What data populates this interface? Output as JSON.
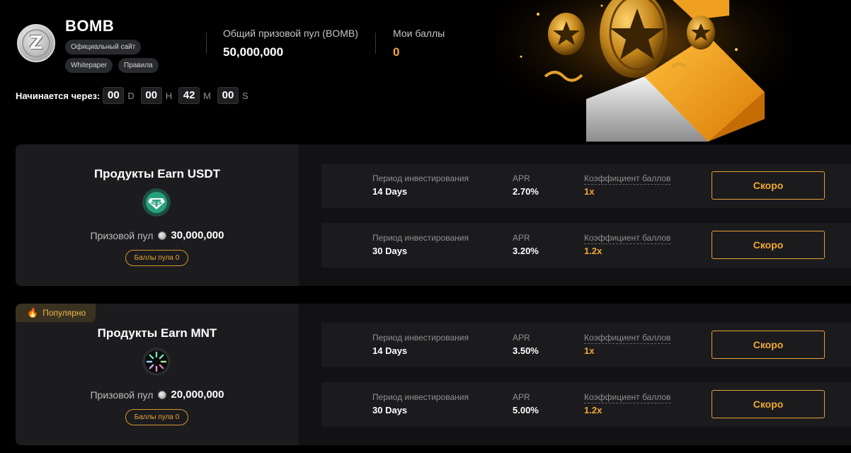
{
  "header": {
    "token_name": "BOMB",
    "token_logo_letter": "Z",
    "links": [
      "Официальный сайт",
      "Whitepaper",
      "Правила"
    ],
    "total_pool_label": "Общий призовой пул (BOMB)",
    "total_pool_value": "50,000,000",
    "my_points_label": "Мои баллы",
    "my_points_value": "0",
    "countdown": {
      "label": "Начинается через:",
      "days": "00",
      "days_unit": "D",
      "hours": "00",
      "hours_unit": "H",
      "minutes": "42",
      "minutes_unit": "M",
      "seconds": "00",
      "seconds_unit": "S"
    }
  },
  "products": [
    {
      "title": "Продукты Earn USDT",
      "icon": "tether-icon",
      "pool_label": "Призовой пул",
      "pool_value": "30,000,000",
      "points_button": "Баллы пула 0",
      "rows": [
        {
          "period_label": "Период инвестирования",
          "period": "14 Days",
          "apr_label": "APR",
          "apr": "2.70%",
          "coef_label": "Коэффициент баллов",
          "coef": "1x",
          "button": "Скоро"
        },
        {
          "period_label": "Период инвестирования",
          "period": "30 Days",
          "apr_label": "APR",
          "apr": "3.20%",
          "coef_label": "Коэффициент баллов",
          "coef": "1.2x",
          "button": "Скоро"
        }
      ]
    },
    {
      "badge": "Популярно",
      "title": "Продукты Earn MNT",
      "icon": "mantle-icon",
      "pool_label": "Призовой пул",
      "pool_value": "20,000,000",
      "points_button": "Баллы пула 0",
      "rows": [
        {
          "period_label": "Период инвестирования",
          "period": "14 Days",
          "apr_label": "APR",
          "apr": "3.50%",
          "coef_label": "Коэффициент баллов",
          "coef": "1x",
          "button": "Скоро"
        },
        {
          "period_label": "Период инвестирования",
          "period": "30 Days",
          "apr_label": "APR",
          "apr": "5.00%",
          "coef_label": "Коэффициент баллов",
          "coef": "1.2x",
          "button": "Скоро"
        }
      ]
    }
  ],
  "colors": {
    "accent": "#f0a833",
    "background": "#000000",
    "panel": "#121214",
    "panel_left": "#1c1c1f",
    "row": "#1b1b1e",
    "tether": "#26a17b"
  }
}
